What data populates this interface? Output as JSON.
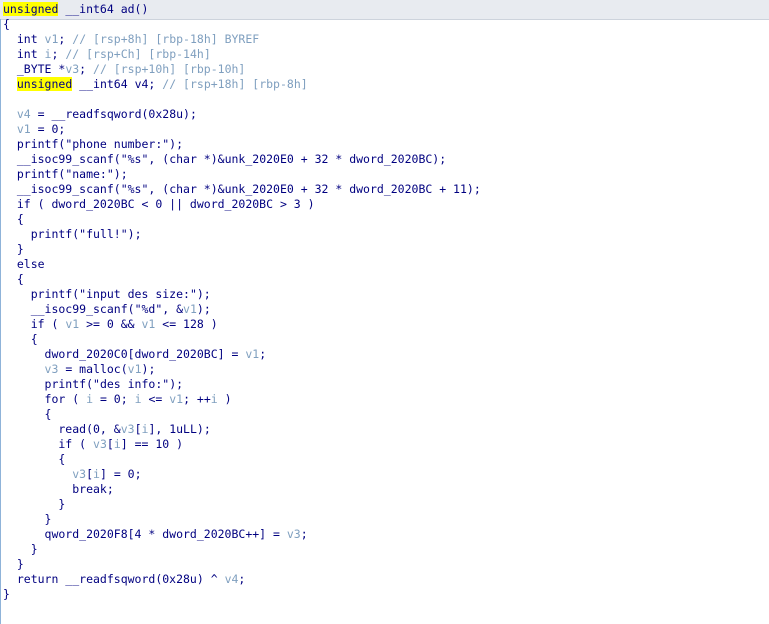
{
  "lines": [
    [
      [
        "unsigned",
        "hl"
      ],
      [
        " __int64 ad()",
        "pl"
      ]
    ],
    [
      [
        "{",
        "pl"
      ]
    ],
    [
      [
        "  int ",
        "ty"
      ],
      [
        "v1",
        "vr"
      ],
      [
        "; ",
        "pl"
      ],
      [
        "// [rsp+8h] [rbp-18h] BYREF",
        "cm"
      ]
    ],
    [
      [
        "  int ",
        "ty"
      ],
      [
        "i",
        "vr"
      ],
      [
        "; ",
        "pl"
      ],
      [
        "// [rsp+Ch] [rbp-14h]",
        "cm"
      ]
    ],
    [
      [
        "  _BYTE *",
        "ty"
      ],
      [
        "v3",
        "vr"
      ],
      [
        "; ",
        "pl"
      ],
      [
        "// [rsp+10h] [rbp-10h]",
        "cm"
      ]
    ],
    [
      [
        "  ",
        "pl"
      ],
      [
        "unsigned",
        "hl"
      ],
      [
        " __int64 ",
        "pl"
      ],
      [
        "v4",
        "pl"
      ],
      [
        "; ",
        "pl"
      ],
      [
        "// [rsp+18h] [rbp-8h]",
        "cm"
      ]
    ],
    [],
    [
      [
        "  ",
        "pl"
      ],
      [
        "v4",
        "vr"
      ],
      [
        " = __readfsqword(0x28u);",
        "pl"
      ]
    ],
    [
      [
        "  ",
        "pl"
      ],
      [
        "v1",
        "vr"
      ],
      [
        " = 0;",
        "pl"
      ]
    ],
    [
      [
        "  printf(",
        "pl"
      ],
      [
        "\"phone number:\"",
        "str"
      ],
      [
        ");",
        "pl"
      ]
    ],
    [
      [
        "  __isoc99_scanf(",
        "pl"
      ],
      [
        "\"%s\"",
        "str"
      ],
      [
        ", (",
        "pl"
      ],
      [
        "char *",
        "ty"
      ],
      [
        ")&unk_2020E0 + 32 * dword_2020BC);",
        "pl"
      ]
    ],
    [
      [
        "  printf(",
        "pl"
      ],
      [
        "\"name:\"",
        "str"
      ],
      [
        ");",
        "pl"
      ]
    ],
    [
      [
        "  __isoc99_scanf(",
        "pl"
      ],
      [
        "\"%s\"",
        "str"
      ],
      [
        ", (",
        "pl"
      ],
      [
        "char *",
        "ty"
      ],
      [
        ")&unk_2020E0 + 32 * dword_2020BC + 11);",
        "pl"
      ]
    ],
    [
      [
        "  if ( dword_2020BC < 0 || dword_2020BC > 3 )",
        "pl"
      ]
    ],
    [
      [
        "  {",
        "pl"
      ]
    ],
    [
      [
        "    printf(",
        "pl"
      ],
      [
        "\"full!\"",
        "str"
      ],
      [
        ");",
        "pl"
      ]
    ],
    [
      [
        "  }",
        "pl"
      ]
    ],
    [
      [
        "  else",
        "pl"
      ]
    ],
    [
      [
        "  {",
        "pl"
      ]
    ],
    [
      [
        "    printf(",
        "pl"
      ],
      [
        "\"input des size:\"",
        "str"
      ],
      [
        ");",
        "pl"
      ]
    ],
    [
      [
        "    __isoc99_scanf(",
        "pl"
      ],
      [
        "\"%d\"",
        "str"
      ],
      [
        ", &",
        "pl"
      ],
      [
        "v1",
        "vr"
      ],
      [
        ");",
        "pl"
      ]
    ],
    [
      [
        "    if ( ",
        "pl"
      ],
      [
        "v1",
        "vr"
      ],
      [
        " >= 0 && ",
        "pl"
      ],
      [
        "v1",
        "vr"
      ],
      [
        " <= 128 )",
        "pl"
      ]
    ],
    [
      [
        "    {",
        "pl"
      ]
    ],
    [
      [
        "      dword_2020C0[dword_2020BC] = ",
        "pl"
      ],
      [
        "v1",
        "vr"
      ],
      [
        ";",
        "pl"
      ]
    ],
    [
      [
        "      ",
        "pl"
      ],
      [
        "v3",
        "vr"
      ],
      [
        " = malloc(",
        "pl"
      ],
      [
        "v1",
        "vr"
      ],
      [
        ");",
        "pl"
      ]
    ],
    [
      [
        "      printf(",
        "pl"
      ],
      [
        "\"des info:\"",
        "str"
      ],
      [
        ");",
        "pl"
      ]
    ],
    [
      [
        "      for ( ",
        "pl"
      ],
      [
        "i",
        "vr"
      ],
      [
        " = 0; ",
        "pl"
      ],
      [
        "i",
        "vr"
      ],
      [
        " <= ",
        "pl"
      ],
      [
        "v1",
        "vr"
      ],
      [
        "; ++",
        "pl"
      ],
      [
        "i",
        "vr"
      ],
      [
        " )",
        "pl"
      ]
    ],
    [
      [
        "      {",
        "pl"
      ]
    ],
    [
      [
        "        read(0, &",
        "pl"
      ],
      [
        "v3",
        "vr"
      ],
      [
        "[",
        "pl"
      ],
      [
        "i",
        "vr"
      ],
      [
        "], 1uLL);",
        "pl"
      ]
    ],
    [
      [
        "        if ( ",
        "pl"
      ],
      [
        "v3",
        "vr"
      ],
      [
        "[",
        "pl"
      ],
      [
        "i",
        "vr"
      ],
      [
        "] == 10 )",
        "pl"
      ]
    ],
    [
      [
        "        {",
        "pl"
      ]
    ],
    [
      [
        "          ",
        "pl"
      ],
      [
        "v3",
        "vr"
      ],
      [
        "[",
        "pl"
      ],
      [
        "i",
        "vr"
      ],
      [
        "] = 0;",
        "pl"
      ]
    ],
    [
      [
        "          break;",
        "pl"
      ]
    ],
    [
      [
        "        }",
        "pl"
      ]
    ],
    [
      [
        "      }",
        "pl"
      ]
    ],
    [
      [
        "      qword_2020F8[4 * dword_2020BC++] = ",
        "pl"
      ],
      [
        "v3",
        "vr"
      ],
      [
        ";",
        "pl"
      ]
    ],
    [
      [
        "    }",
        "pl"
      ]
    ],
    [
      [
        "  }",
        "pl"
      ]
    ],
    [
      [
        "  return __readfsqword(0x28u) ^ ",
        "pl"
      ],
      [
        "v4",
        "vr"
      ],
      [
        ";",
        "pl"
      ]
    ],
    [
      [
        "}",
        "pl"
      ]
    ]
  ]
}
